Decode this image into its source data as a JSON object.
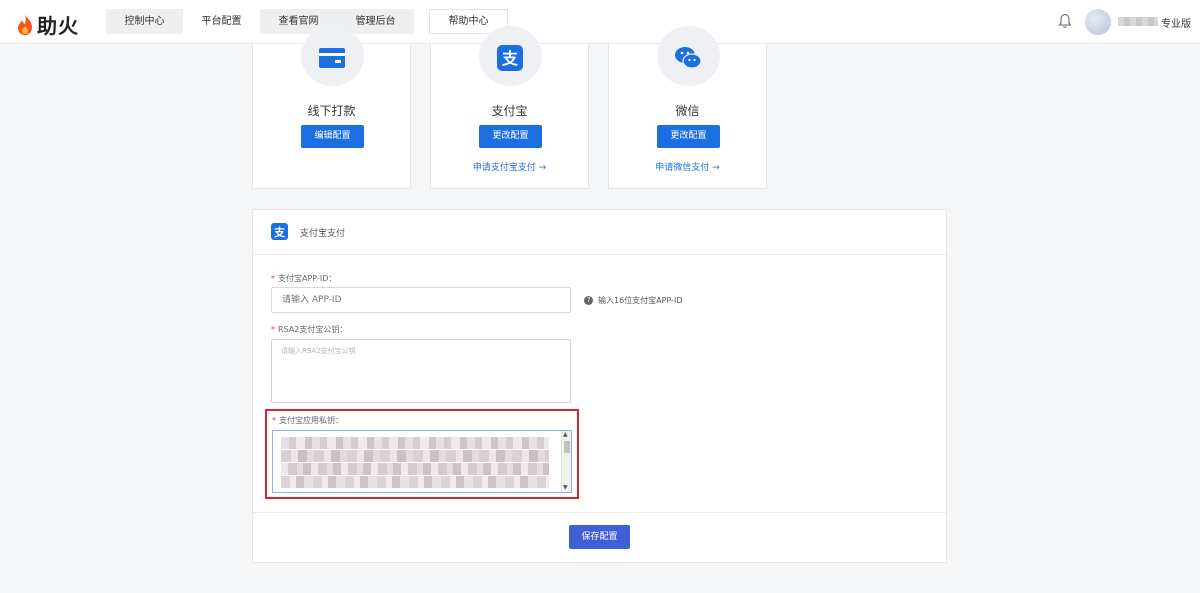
{
  "brand": {
    "name": "助火"
  },
  "nav": {
    "tabs": [
      {
        "label": "控制中心"
      },
      {
        "label": "平台配置"
      },
      {
        "label": "查看官网"
      },
      {
        "label": "管理后台"
      }
    ],
    "help": "帮助中心"
  },
  "user": {
    "plan": "专业版"
  },
  "payment_methods": [
    {
      "title": "线下打款",
      "button": "编辑配置",
      "link": ""
    },
    {
      "title": "支付宝",
      "button": "更改配置",
      "link": "申请支付宝支付 →"
    },
    {
      "title": "微信",
      "button": "更改配置",
      "link": "申请微信支付 →"
    }
  ],
  "config": {
    "title": "支付宝支付",
    "app_id": {
      "label": "支付宝APP-ID：",
      "placeholder": "请输入 APP-ID",
      "hint": "输入16位支付宝APP-ID"
    },
    "public_key": {
      "label": "RSA2支付宝公钥：",
      "placeholder": "请输入RSA2支付宝公钥"
    },
    "private_key": {
      "label": "支付宝应用私钥："
    },
    "save": "保存配置"
  },
  "colors": {
    "primary": "#1c6fe0",
    "save": "#3f5fd6",
    "highlight": "#e02424",
    "required": "#e53935"
  }
}
